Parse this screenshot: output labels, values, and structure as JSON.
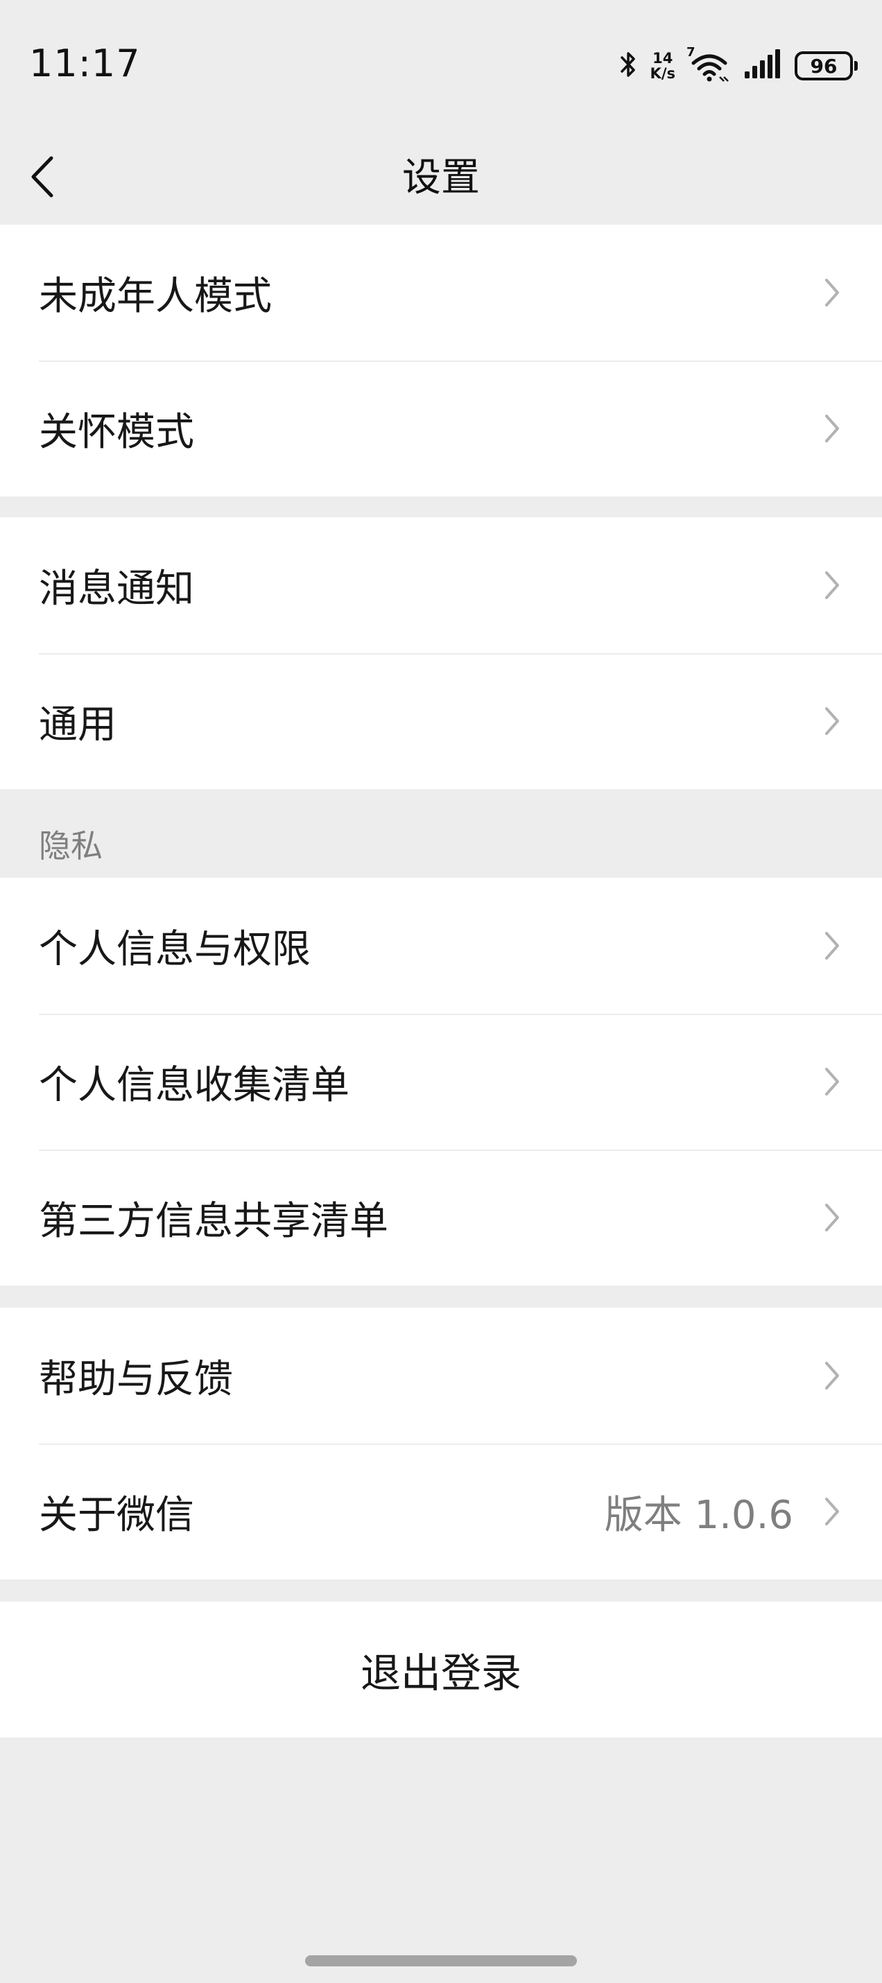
{
  "status_bar": {
    "time": "11:17",
    "net_speed_value": "14",
    "net_speed_unit": "K/s",
    "wifi_badge": "7",
    "battery": "96"
  },
  "header": {
    "title": "设置",
    "back_icon": "chevron-left-icon"
  },
  "groups": {
    "mode": {
      "items": [
        {
          "label": "未成年人模式"
        },
        {
          "label": "关怀模式"
        }
      ]
    },
    "general": {
      "items": [
        {
          "label": "消息通知"
        },
        {
          "label": "通用"
        }
      ]
    },
    "privacy": {
      "header": "隐私",
      "items": [
        {
          "label": "个人信息与权限"
        },
        {
          "label": "个人信息收集清单"
        },
        {
          "label": "第三方信息共享清单"
        }
      ]
    },
    "about": {
      "items": [
        {
          "label": "帮助与反馈"
        },
        {
          "label": "关于微信",
          "value": "版本 1.0.6"
        }
      ]
    }
  },
  "logout_label": "退出登录",
  "colors": {
    "background": "#ededed",
    "card": "#ffffff",
    "text": "#181818",
    "secondary_text": "#7f7f7f",
    "chevron": "#b2b2b2"
  }
}
